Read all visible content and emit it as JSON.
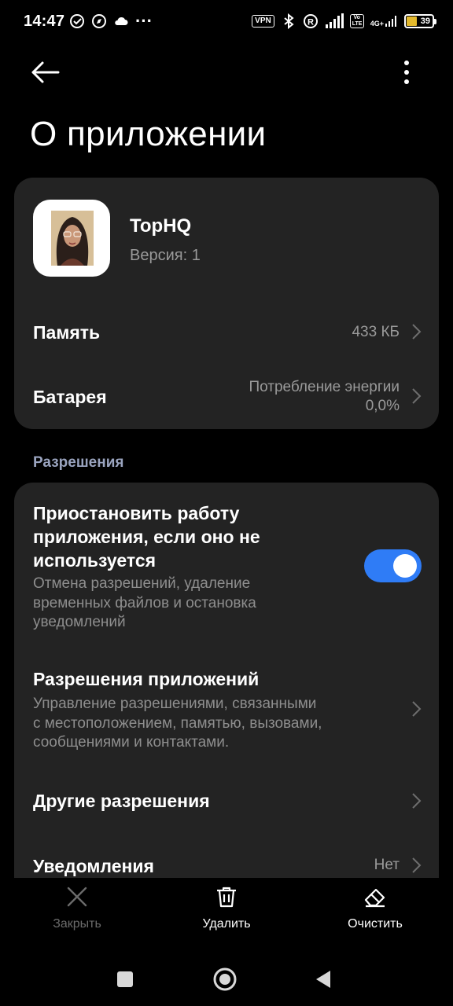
{
  "status_bar": {
    "time": "14:47",
    "vpn": "VPN",
    "network": "4G+",
    "volte": "Vo LTE",
    "battery_level": "39",
    "battery_color": "#e3b92d"
  },
  "header": {
    "title": "О приложении"
  },
  "app": {
    "name": "TopHQ",
    "version": "Версия: 1"
  },
  "details": {
    "memory_label": "Память",
    "memory_value": "433 КБ",
    "battery_label": "Батарея",
    "battery_value_line1": "Потребление энергии",
    "battery_value_line2": "0,0%"
  },
  "permissions": {
    "section_title": "Разрешения",
    "pause_title_lines": [
      "Приостановить работу",
      "приложения, если оно не",
      "используется"
    ],
    "pause_desc_lines": [
      "Отмена разрешений, удаление",
      "временных файлов и остановка",
      "уведомлений"
    ],
    "pause_enabled": true,
    "app_perms_title": "Разрешения приложений",
    "app_perms_desc_lines": [
      "Управление разрешениями, связанными",
      "с местоположением, памятью, вызовами,",
      "сообщениями и контактами."
    ],
    "other_perms_title": "Другие разрешения",
    "notifications_title": "Уведомления",
    "notifications_value": "Нет"
  },
  "actions": {
    "close_label": "Закрыть",
    "delete_label": "Удалить",
    "clear_label": "Очистить"
  },
  "colors": {
    "accent": "#2f7cf6",
    "card_bg": "#232323",
    "section_label": "#9aa4bf"
  }
}
